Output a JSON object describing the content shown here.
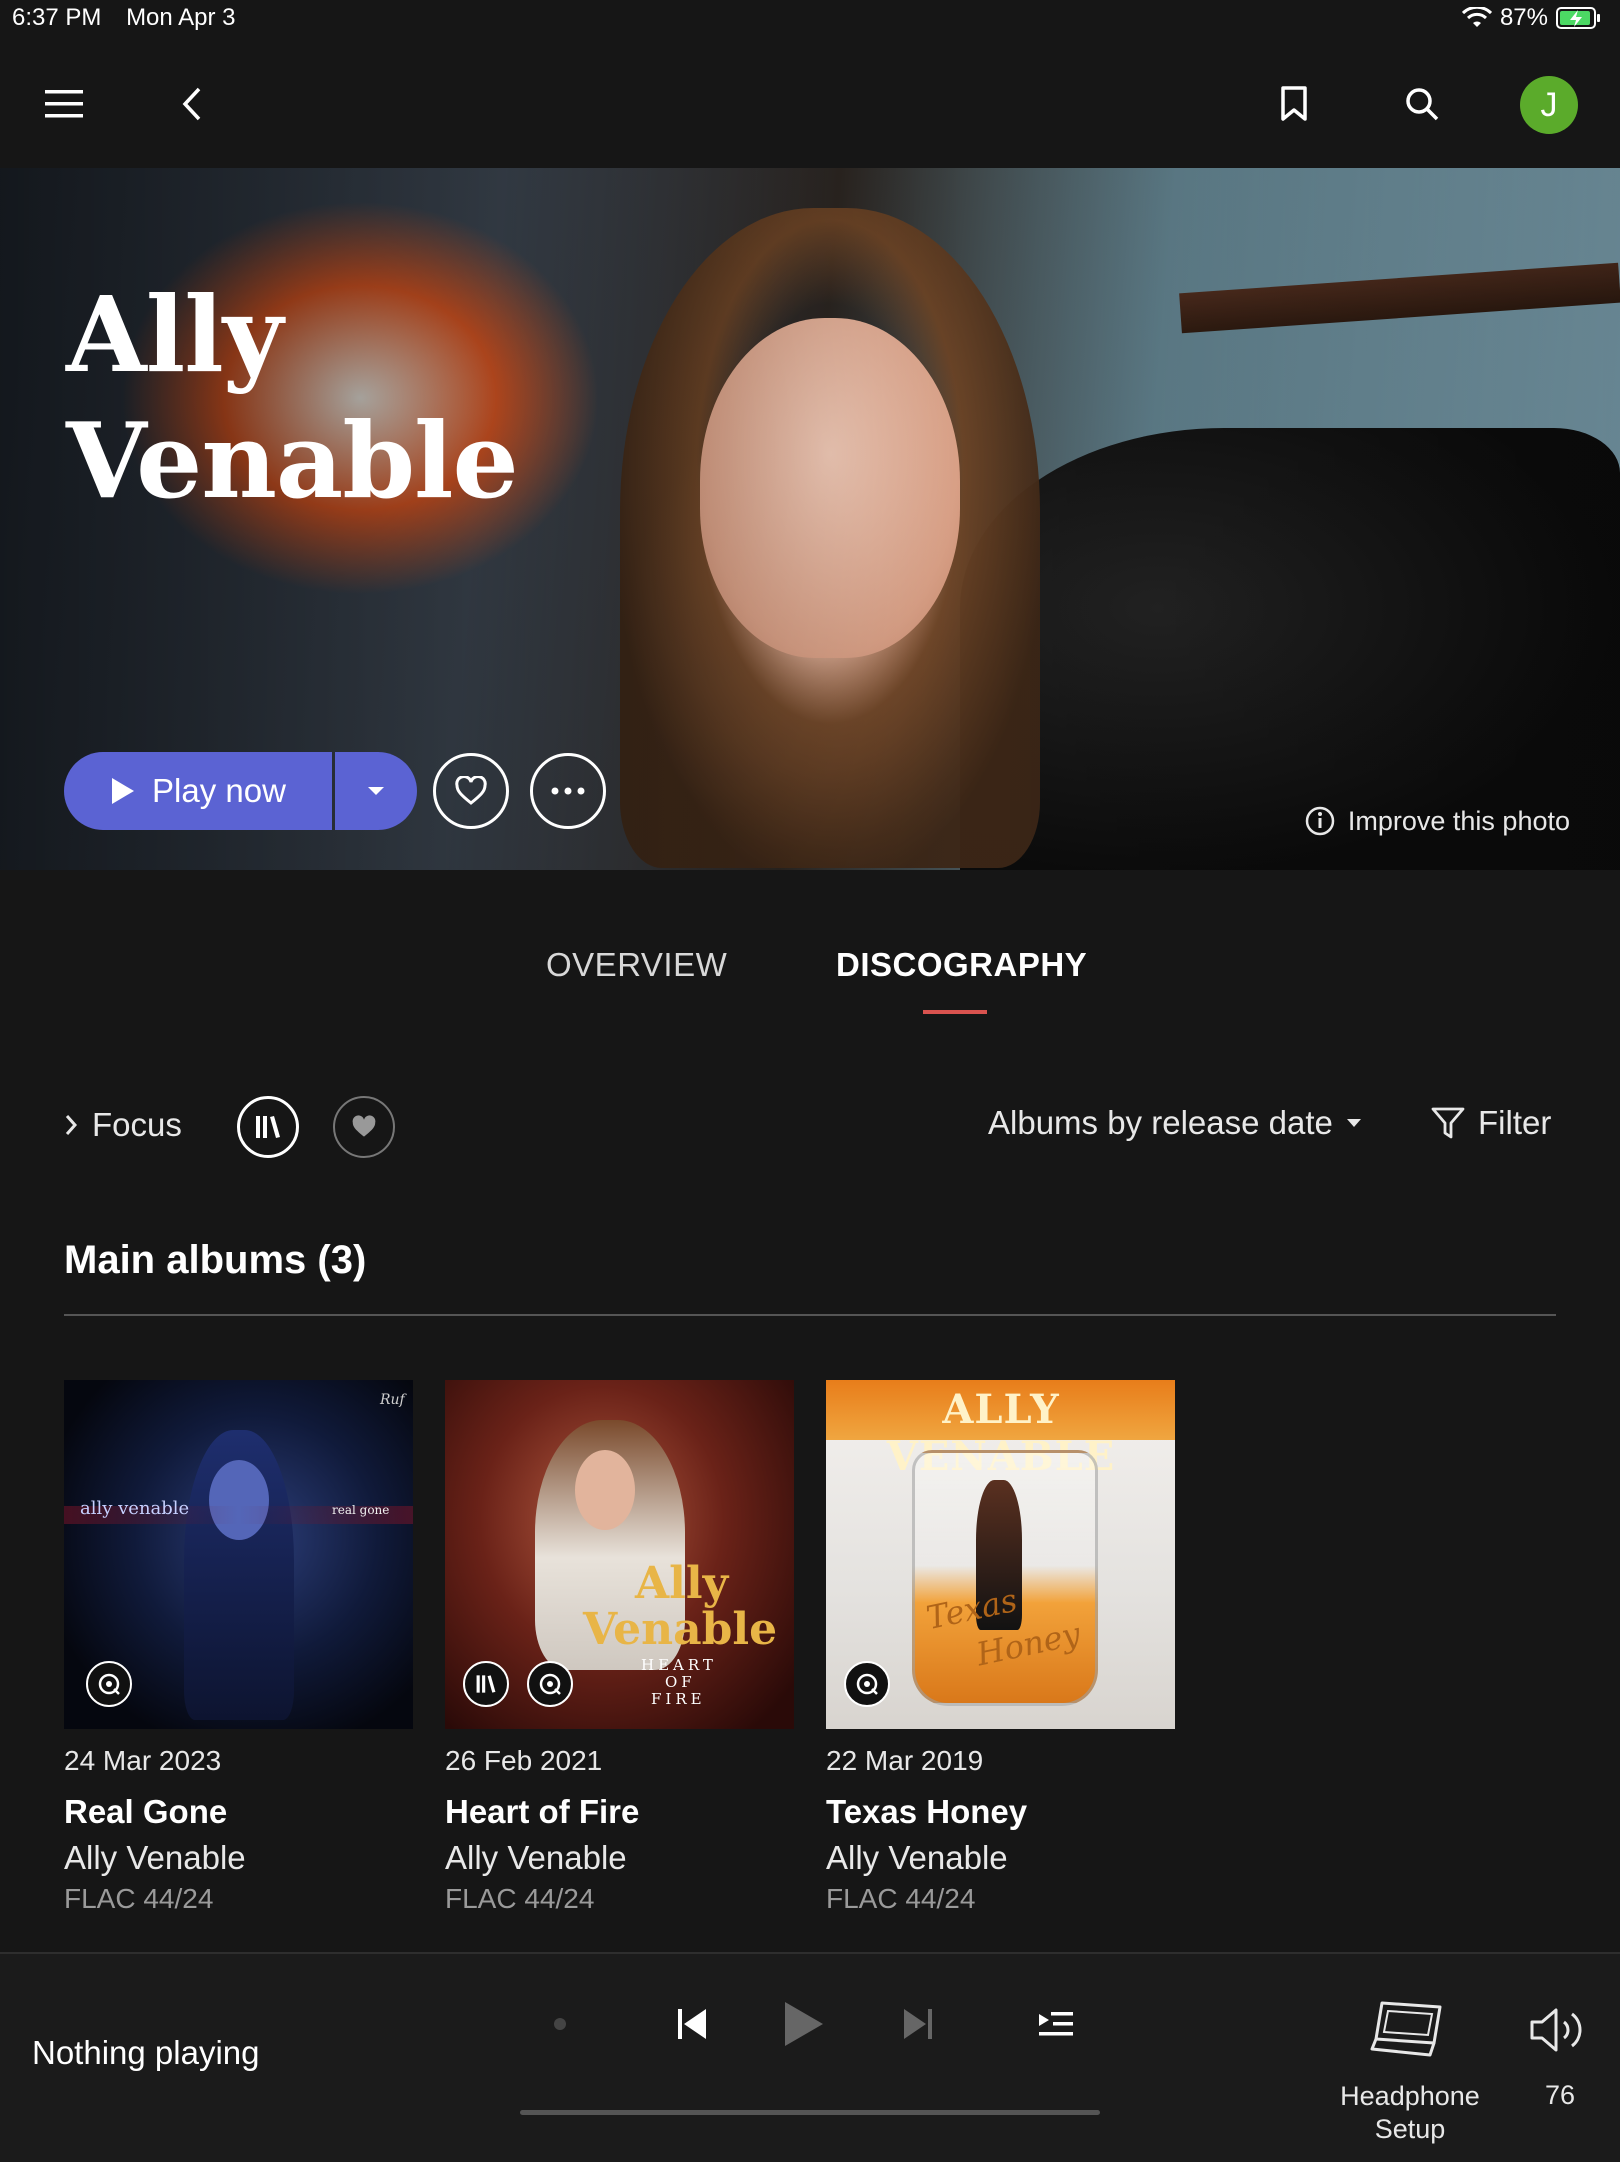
{
  "status": {
    "time": "6:37 PM",
    "date": "Mon Apr 3",
    "battery": "87%"
  },
  "nav": {
    "avatar_letter": "J",
    "avatar_color": "#5bab2b"
  },
  "hero": {
    "artist_first": "Ally",
    "artist_last": "Venable",
    "play_label": "Play now",
    "improve_label": "Improve this photo"
  },
  "tabs": {
    "overview": "OVERVIEW",
    "discography": "DISCOGRAPHY",
    "active": "discography"
  },
  "toolbar": {
    "focus_label": "Focus",
    "sort_label": "Albums by release date",
    "filter_label": "Filter"
  },
  "section": {
    "title": "Main albums (3)"
  },
  "albums": [
    {
      "date": "24 Mar 2023",
      "title": "Real Gone",
      "artist": "Ally Venable",
      "format": "FLAC 44/24",
      "cover_text_left": "ally venable",
      "cover_text_right": "real gone",
      "cover_logo": "Ruf"
    },
    {
      "date": "26 Feb 2021",
      "title": "Heart of Fire",
      "artist": "Ally Venable",
      "format": "FLAC 44/24",
      "cover_text_1": "Ally",
      "cover_text_2": "Venable",
      "cover_text_3": "HEART",
      "cover_text_4": "OF",
      "cover_text_5": "FIRE"
    },
    {
      "date": "22 Mar 2019",
      "title": "Texas Honey",
      "artist": "Ally Venable",
      "format": "FLAC 44/24",
      "cover_text_top": "ALLY VENABLE",
      "cover_text_1": "Texas",
      "cover_text_2": "Honey"
    }
  ],
  "player": {
    "status": "Nothing playing",
    "device_label": "Headphone Setup",
    "volume": "76"
  },
  "colors": {
    "accent": "#5b63d3",
    "tab_underline": "#d9534f",
    "background": "#161616"
  }
}
